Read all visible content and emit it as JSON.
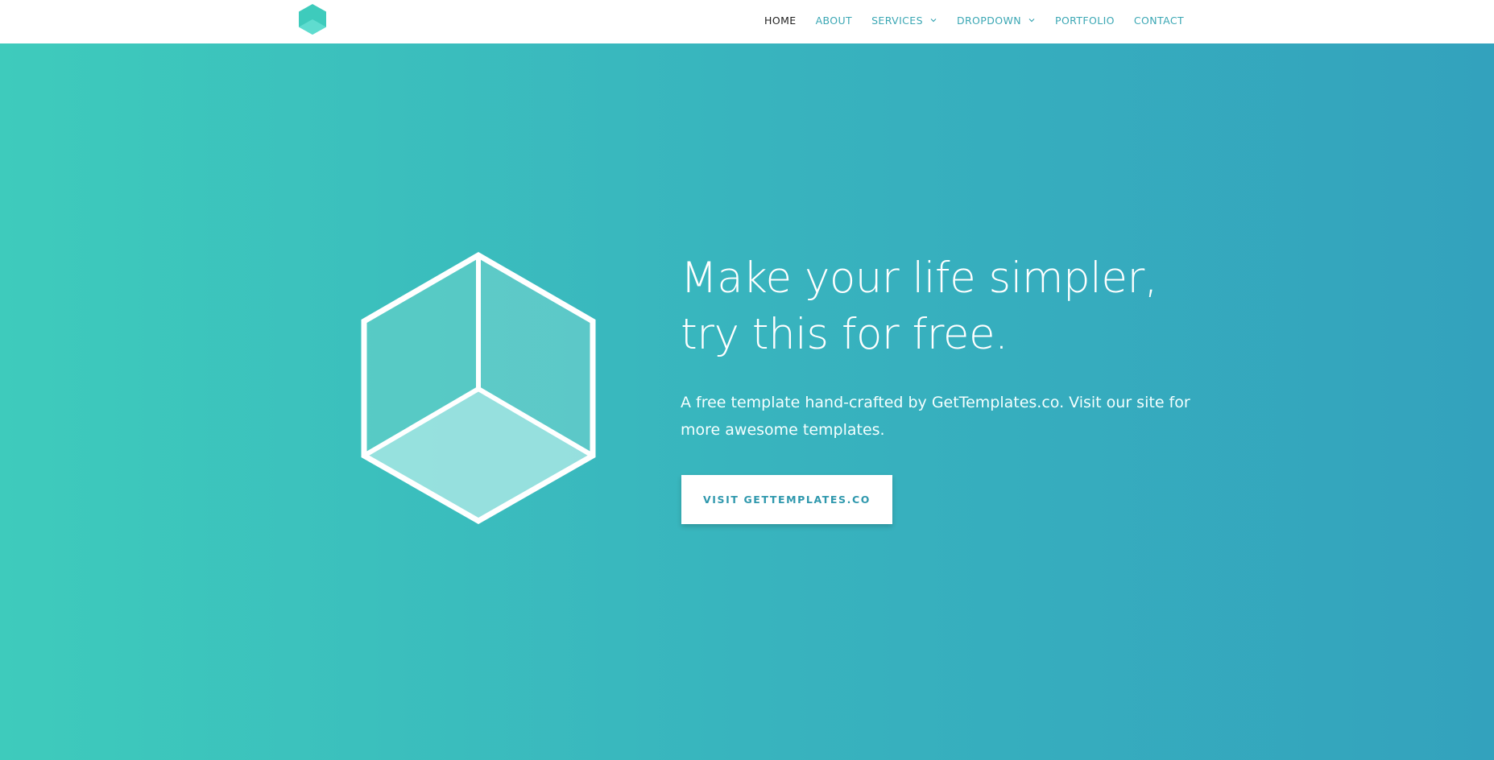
{
  "nav": {
    "items": [
      {
        "label": "HOME",
        "active": true,
        "has_dropdown": false
      },
      {
        "label": "ABOUT",
        "active": false,
        "has_dropdown": false
      },
      {
        "label": "SERVICES",
        "active": false,
        "has_dropdown": true
      },
      {
        "label": "DROPDOWN",
        "active": false,
        "has_dropdown": true
      },
      {
        "label": "PORTFOLIO",
        "active": false,
        "has_dropdown": false
      },
      {
        "label": "CONTACT",
        "active": false,
        "has_dropdown": false
      }
    ]
  },
  "logo": {
    "icon": "hexagon-cube-icon",
    "color": "#3ecbbc"
  },
  "hero": {
    "headline_line1": "Make your life simpler,",
    "headline_line2": "try this for free.",
    "subtext": "A free template hand-crafted by GetTemplates.co. Visit our site for more awesome templates.",
    "cta_label": "VISIT GETTEMPLATES.CO",
    "illustration": "cube-icon"
  },
  "colors": {
    "gradient_start": "#3ecbbc",
    "gradient_end": "#33a2bd",
    "nav_link": "#3ba7b4",
    "nav_active": "#222222",
    "cta_text": "#2f98ad"
  }
}
